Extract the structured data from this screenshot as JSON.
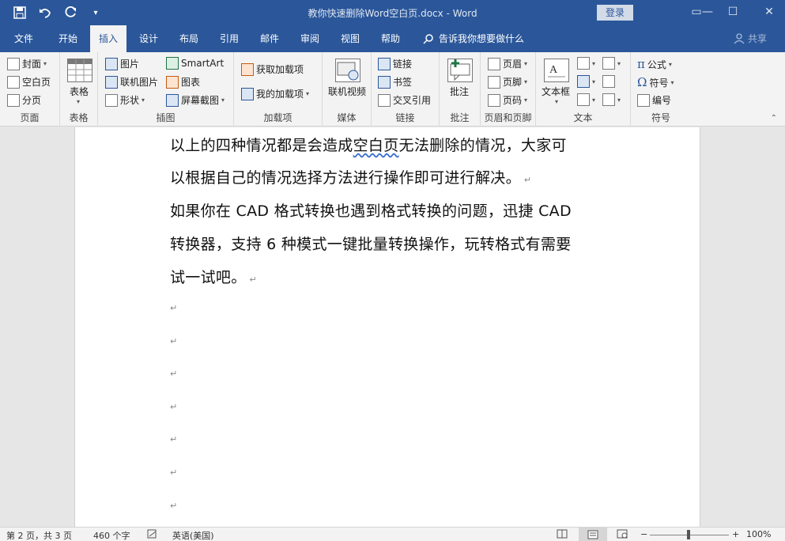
{
  "window": {
    "title": "教你快速删除Word空白页.docx  -  Word",
    "login": "登录",
    "controls": [
      "▭",
      "—",
      "☐",
      "✕"
    ]
  },
  "qat": {
    "save": "💾",
    "undo": "↶",
    "redo": "↻",
    "more": "▾"
  },
  "tabs": [
    "文件",
    "开始",
    "插入",
    "设计",
    "布局",
    "引用",
    "邮件",
    "审阅",
    "视图",
    "帮助"
  ],
  "tellme": "告诉我你想要做什么",
  "share": "共享",
  "ribbon": {
    "pages": {
      "label": "页面",
      "items": [
        "封面",
        "空白页",
        "分页"
      ]
    },
    "tables": {
      "label": "表格",
      "item": "表格"
    },
    "illustrations": {
      "label": "插图",
      "items": [
        "图片",
        "联机图片",
        "形状",
        "SmartArt",
        "图表",
        "屏幕截图"
      ]
    },
    "addins": {
      "label": "加载项",
      "items": [
        "获取加载项",
        "我的加载项"
      ]
    },
    "media": {
      "label": "媒体",
      "item": "联机视频"
    },
    "links": {
      "label": "链接",
      "items": [
        "链接",
        "书签",
        "交叉引用"
      ]
    },
    "comments": {
      "label": "批注",
      "item": "批注"
    },
    "headerfooter": {
      "label": "页眉和页脚",
      "items": [
        "页眉",
        "页脚",
        "页码"
      ]
    },
    "text": {
      "label": "文本",
      "item": "文本框"
    },
    "symbols": {
      "label": "符号",
      "items": [
        "公式",
        "符号",
        "编号"
      ]
    }
  },
  "document": {
    "lines": [
      "以上的四种情况都是会造成空白页无法删除的情况，大家可",
      "以根据自己的情况选择方法进行操作即可进行解决。",
      "如果你在 CAD 格式转换也遇到格式转换的问题，迅捷 CAD",
      "转换器，支持 6 种模式一键批量转换操作，玩转格式有需要",
      "试一试吧。"
    ],
    "squiggle_word": "空白页",
    "para_mark": "↵"
  },
  "status": {
    "page": "第 2 页，共 3 页",
    "words": "460 个字",
    "language": "英语(美国)",
    "zoom": "100%"
  }
}
